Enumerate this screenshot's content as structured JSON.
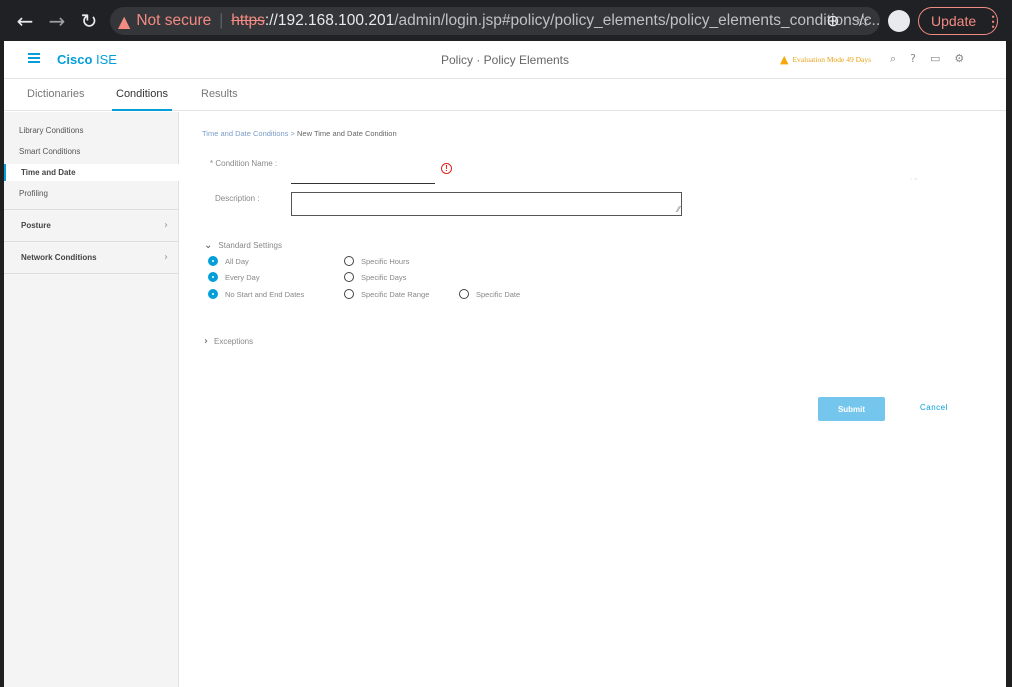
{
  "browser": {
    "not_secure": "Not secure",
    "url_scheme": "https",
    "url_host": "://192.168.100.201",
    "url_path": "/admin/login.jsp#policy/policy_elements/policy_elements_conditions/c...",
    "update_label": "Update"
  },
  "header": {
    "brand_bold": "Cisco",
    "brand_rest": " ISE",
    "title": "Policy · Policy Elements",
    "eval_text": "Evaluation Mode 49 Days"
  },
  "tabs": [
    {
      "label": "Dictionaries"
    },
    {
      "label": "Conditions"
    },
    {
      "label": "Results"
    }
  ],
  "sidebar": {
    "items": [
      {
        "label": "Library Conditions"
      },
      {
        "label": "Smart Conditions"
      },
      {
        "label": "Time and Date"
      },
      {
        "label": "Profiling"
      },
      {
        "label": "Posture"
      },
      {
        "label": "Network Conditions"
      }
    ]
  },
  "breadcrumb": {
    "parent": "Time and Date Conditions",
    "separator": ">",
    "current": "New Time and Date Condition"
  },
  "form": {
    "condition_name_label": "* Condition Name :",
    "description_label": "Description :",
    "standard_settings": "Standard Settings",
    "exceptions": "Exceptions",
    "radios": {
      "all_day": "All Day",
      "specific_hours": "Specific Hours",
      "every_day": "Every Day",
      "specific_days": "Specific Days",
      "no_start_end": "No Start and End Dates",
      "specific_date_range": "Specific Date Range",
      "specific_date": "Specific Date"
    },
    "submit_label": "Submit",
    "cancel_label": "Cancel"
  },
  "colors": {
    "accent": "#049fd9",
    "warning": "#f6a80a",
    "error": "#e2231a"
  }
}
